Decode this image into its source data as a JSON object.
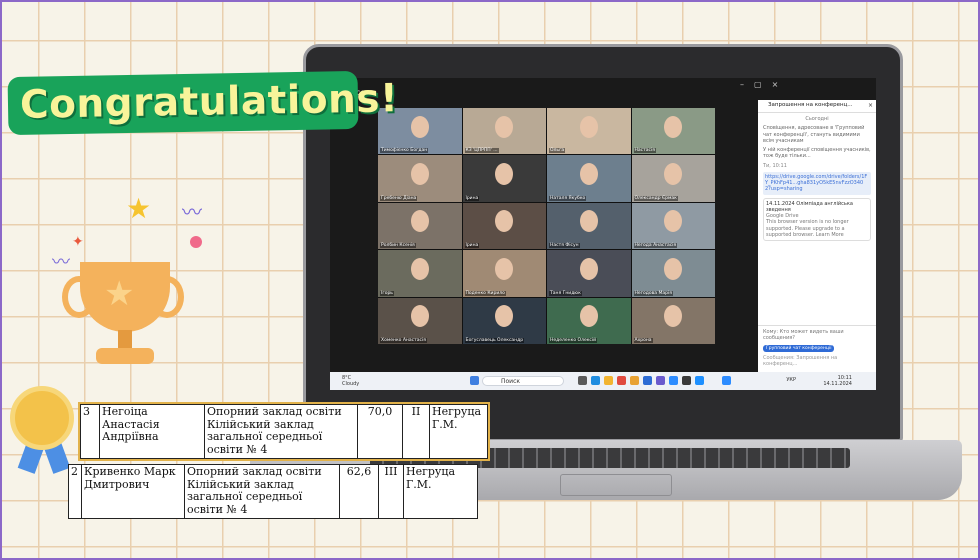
{
  "sticker": {
    "text": "Congratulations!"
  },
  "window": {
    "title_fragment": "ce",
    "controls": [
      "–",
      "▢",
      "×"
    ]
  },
  "participants": [
    {
      "name": "Тимофієнко Богдан"
    },
    {
      "name": "КЗ 'ЦПРПП' ..."
    },
    {
      "name": "Ольга"
    },
    {
      "name": "Настасія"
    },
    {
      "name": "Гребеню Діана"
    },
    {
      "name": "Ірина"
    },
    {
      "name": "Наталя Якубко"
    },
    {
      "name": "Олександр Єрмак"
    },
    {
      "name": "Ролбин Ксенія"
    },
    {
      "name": "Ірина"
    },
    {
      "name": "Настя Фісун"
    },
    {
      "name": "Негода Анастасія"
    },
    {
      "name": "Ігорь"
    },
    {
      "name": "Поденко Кирило"
    },
    {
      "name": "Таня Гнидюк"
    },
    {
      "name": "Негодова Марія"
    },
    {
      "name": "Хоменко Анастасія"
    },
    {
      "name": "Богуславець Олександр"
    },
    {
      "name": "Неделенко Олексій"
    },
    {
      "name": "Ахрона"
    },
    {
      "name": "Марія Примачко"
    },
    {
      "name": "Мельник Карина"
    },
    {
      "name": "Олена"
    },
    {
      "name": "Daina Yanson"
    }
  ],
  "center_tile_name": "Олена",
  "chat": {
    "title": "Запрошення на конференц...",
    "close": "×",
    "today": "Сьогодні",
    "system_note": "Сповіщення, адресоване в 'Групповий чат конференції', стануть видимими всім учасникам",
    "meeting_note": "У ній конференції сповіщення учасників, тож буде тільки...",
    "sender": "Ти, 10:11",
    "link": "https://drive.google.com/drive/folders/1FY_PKhFp41...gha831yO5kE5nvFzzO3402?usp=sharing",
    "card_title": "14.11.2024 Олімпіада англійська зведення",
    "card_sub": "Google Drive",
    "card_text": "This browser version is no longer supported. Please upgrade to a supported browser. Learn More",
    "footer_label": "Кому: Кто может видеть ваши сообщения?",
    "chip": "Групповий чат конференції",
    "placeholder": "Сообщения: Запрошення на конференц..."
  },
  "taskbar": {
    "temp": "8°C",
    "weather": "Cloudy",
    "search": "Поиск",
    "lang": "УКР",
    "time": "10:11",
    "date": "14.11.2024"
  },
  "results": [
    {
      "place_no": "3",
      "name": "Негоіца Анастасія Андріївна",
      "school": "Опорний заклад освіти Кілійський заклад загальної середньої освіти № 4",
      "score": "70,0",
      "rank": "II",
      "teacher": "Негруца Г.М."
    },
    {
      "place_no": "2",
      "name": "Кривенко Марк Дмитрович",
      "school": "Опорний заклад освіти Кілійський заклад загальної середньої освіти № 4",
      "score": "62,6",
      "rank": "III",
      "teacher": "Негруца Г.М."
    }
  ],
  "colors": {
    "sticker_bg": "#19a35a",
    "sticker_text": "#f8f49a",
    "grid_line": "#e9cfae",
    "frame": "#8c68c8"
  }
}
